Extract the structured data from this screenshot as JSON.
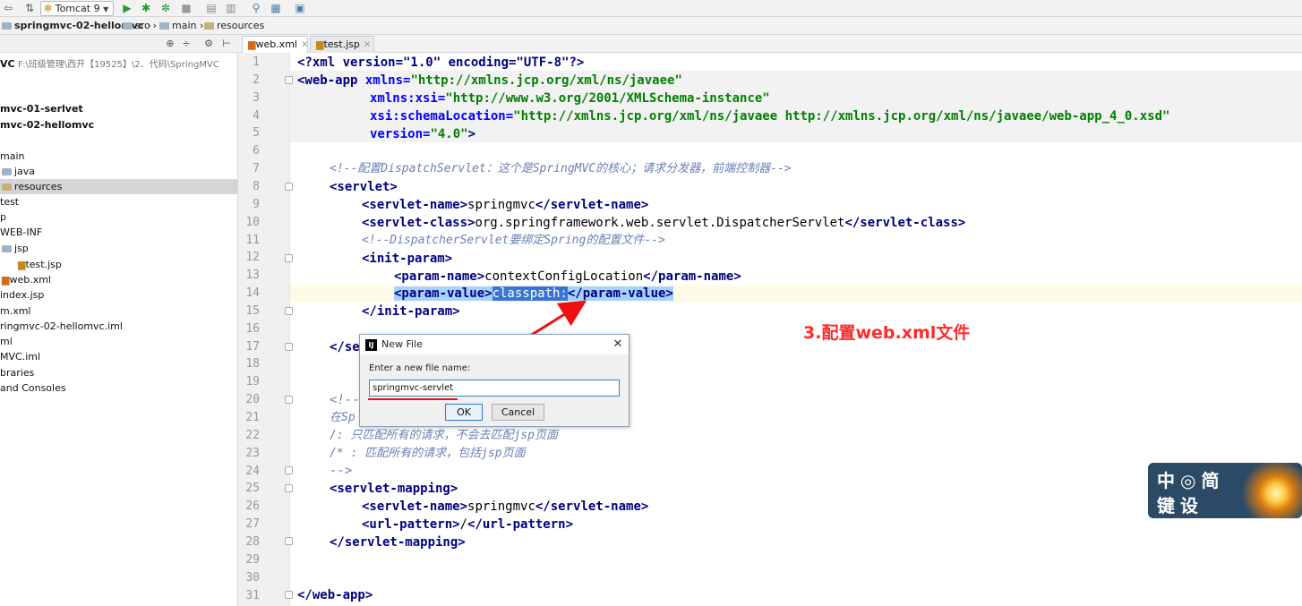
{
  "toolbar": {
    "run_config": "Tomcat 9",
    "icons": [
      "back-icon",
      "sync-icon",
      "tomcat-icon",
      "run-icon",
      "debug-icon",
      "coverage-icon",
      "stop-icon",
      "build-icon",
      "profile-icon",
      "vcs-icon",
      "structure-icon",
      "deploy-icon"
    ]
  },
  "breadcrumb": {
    "project": "springmvc-02-hellomvc",
    "items": [
      "src",
      "main",
      "resources"
    ]
  },
  "project_panel": {
    "root_label": "VC",
    "root_path": "F:\\班级管理\\西开【19525】\\2、代码\\SpringMVC",
    "items": [
      {
        "label": "mvc-01-serlvet",
        "bold": true
      },
      {
        "label": "mvc-02-hellomvc",
        "bold": true
      },
      {
        "label": "main"
      },
      {
        "label": "java"
      },
      {
        "label": "resources"
      },
      {
        "label": "test"
      },
      {
        "label": "p"
      },
      {
        "label": "WEB-INF"
      },
      {
        "label": "jsp"
      },
      {
        "label": "test.jsp"
      },
      {
        "label": "web.xml"
      },
      {
        "label": "index.jsp"
      },
      {
        "label": "m.xml"
      },
      {
        "label": "ringmvc-02-hellomvc.iml"
      },
      {
        "label": "ml"
      },
      {
        "label": "MVC.iml"
      },
      {
        "label": "braries"
      },
      {
        "label": "and Consoles"
      }
    ]
  },
  "tabs": [
    {
      "label": "web.xml",
      "active": true
    },
    {
      "label": "test.jsp",
      "active": false
    }
  ],
  "gutter": {
    "line_numbers": [
      "1",
      "2",
      "3",
      "4",
      "5",
      "6",
      "7",
      "8",
      "9",
      "10",
      "11",
      "12",
      "13",
      "14",
      "15",
      "16",
      "17",
      "18",
      "19",
      "20",
      "21",
      "22",
      "23",
      "24",
      "25",
      "26",
      "27",
      "28",
      "29",
      "30",
      "31"
    ]
  },
  "code": {
    "l1_a": "<?",
    "l1_b": "xml version=\"1.0\" encoding=\"UTF-8\"",
    "l1_c": "?>",
    "l2_tag": "<web-app ",
    "l2_attr": "xmlns=",
    "l2_val": "\"http://xmlns.jcp.org/xml/ns/javaee\"",
    "l3_attr": "xmlns:xsi=",
    "l3_val": "\"http://www.w3.org/2001/XMLSchema-instance\"",
    "l4_attr": "xsi:schemaLocation=",
    "l4_val": "\"http://xmlns.jcp.org/xml/ns/javaee http://xmlns.jcp.org/xml/ns/javaee/web-app_4_0.xsd\"",
    "l5_attr": "version=",
    "l5_val": "\"4.0\"",
    "l5_end": ">",
    "l7": "<!--配置DispatchServlet：这个是SpringMVC的核心；请求分发器，前端控制器-->",
    "l8": "<servlet>",
    "l9_o": "<servlet-name>",
    "l9_t": "springmvc",
    "l9_c": "</servlet-name>",
    "l10_o": "<servlet-class>",
    "l10_t": "org.springframework.web.servlet.DispatcherServlet",
    "l10_c": "</servlet-class>",
    "l11": "<!--DispatcherServlet要绑定Spring的配置文件-->",
    "l12": "<init-param>",
    "l13_o": "<param-name>",
    "l13_t": "contextConfigLocation",
    "l13_c": "</param-name>",
    "l14_o": "<param-value>",
    "l14_t": "classpath:",
    "l14_c": "</param-value>",
    "l15": "</init-param>",
    "l17": "</se",
    "l20": "<!--",
    "l21": "在Sp",
    "l22": "/: 只匹配所有的请求，不会去匹配jsp页面",
    "l23": "/* : 匹配所有的请求，包括jsp页面",
    "l24": "-->",
    "l25": "<servlet-mapping>",
    "l26_o": "<servlet-name>",
    "l26_t": "springmvc",
    "l26_c": "</servlet-name>",
    "l27_o": "<url-pattern>",
    "l27_t": "/",
    "l27_c": "</url-pattern>",
    "l28": "</servlet-mapping>",
    "l31": "</web-app>"
  },
  "annotation": "3.配置web.xml文件",
  "dialog": {
    "title": "New File",
    "logo": "IJ",
    "prompt": "Enter a new file name:",
    "value": "springmvc-servlet",
    "ok": "OK",
    "cancel": "Cancel",
    "close": "✕"
  },
  "watermark": {
    "line1": "中◎简",
    "line2": "键设"
  },
  "colors": {
    "annotation_red": "#ff2a2a",
    "tag_blue": "#000080",
    "attr_blue": "#0000ff",
    "value_green": "#008000",
    "selection": "#a6d2ff"
  }
}
